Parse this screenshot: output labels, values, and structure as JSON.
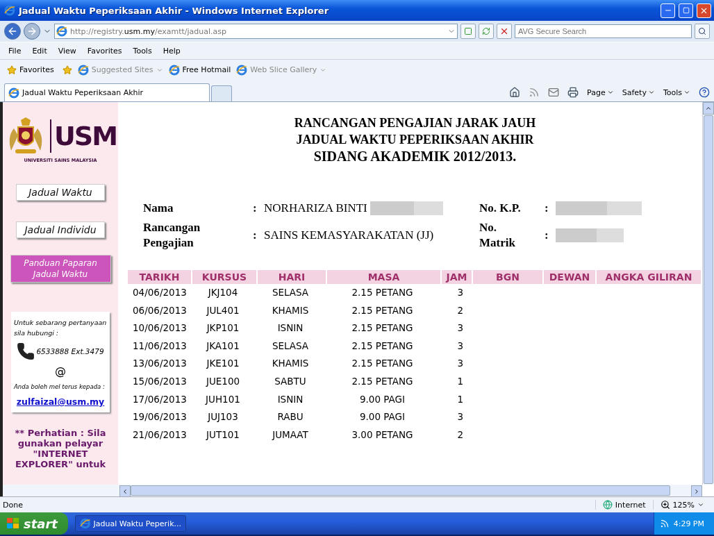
{
  "window": {
    "title": "Jadual Waktu Peperiksaan Akhir - Windows Internet Explorer"
  },
  "address_bar": {
    "url_prefix": "http://registry.",
    "url_host": "usm.my",
    "url_path": "/examtt/jadual.asp",
    "search_placeholder": "AVG Secure Search"
  },
  "menu": [
    "File",
    "Edit",
    "View",
    "Favorites",
    "Tools",
    "Help"
  ],
  "favorites_bar": {
    "favorites": "Favorites",
    "links": [
      {
        "label": "Suggested Sites",
        "dropdown": true,
        "dimmed": true
      },
      {
        "label": "Free Hotmail",
        "dropdown": false,
        "dimmed": false
      },
      {
        "label": "Web Slice Gallery",
        "dropdown": true,
        "dimmed": true
      }
    ]
  },
  "tabs": [
    {
      "label": "Jadual Waktu Peperiksaan Akhir",
      "selected": true
    }
  ],
  "command_bar": [
    "Page",
    "Safety",
    "Tools"
  ],
  "sidebar": {
    "logo_text": "USM",
    "logo_caption": "UNIVERSITI SAINS MALAYSIA",
    "nav": [
      {
        "label": "Jadual Waktu",
        "kind": "plain"
      },
      {
        "label": "Jadual Individu",
        "kind": "plain"
      },
      {
        "label": "Panduan Paparan Jadual Waktu",
        "kind": "highlight"
      }
    ],
    "contact": {
      "intro": "Untuk sebarang pertanyaan sila hubungi :",
      "phone": "6533888 Ext.3479",
      "at": "@",
      "mail_note": "Anda boleh mel terus kepada :",
      "email": "zulfaizal@usm.my"
    },
    "notice": "** Perhatian : Sila gunakan pelayar \"INTERNET EXPLORER\" untuk"
  },
  "heading": [
    "RANCANGAN PENGAJIAN JARAK JAUH",
    "JADUAL WAKTU PEPERIKSAAN AKHIR",
    "SIDANG AKADEMIK 2012/2013."
  ],
  "info": [
    {
      "label": "Nama",
      "separator": ":",
      "value": "NORHARIZA BINTI",
      "redacted": true
    },
    {
      "label": "No. K.P.",
      "separator": ":",
      "redacted": true
    },
    {
      "label": "Rancangan Pengajian",
      "separator": ":",
      "value": "SAINS KEMASYARAKATAN (JJ)",
      "redacted": false
    },
    {
      "label": "No. Matrik",
      "separator": ":",
      "redacted": true
    }
  ],
  "table": {
    "columns": [
      "TARIKH",
      "KURSUS",
      "HARI",
      "MASA",
      "JAM",
      "BGN",
      "DEWAN",
      "ANGKA GILIRAN"
    ],
    "rows": [
      [
        "04/06/2013",
        "JKJ104",
        "SELASA",
        "2.15 PETANG",
        "3"
      ],
      [
        "06/06/2013",
        "JUL401",
        "KHAMIS",
        "2.15 PETANG",
        "2"
      ],
      [
        "10/06/2013",
        "JKP101",
        "ISNIN",
        "2.15 PETANG",
        "3"
      ],
      [
        "11/06/2013",
        "JKA101",
        "SELASA",
        "2.15 PETANG",
        "3"
      ],
      [
        "13/06/2013",
        "JKE101",
        "KHAMIS",
        "2.15 PETANG",
        "3"
      ],
      [
        "15/06/2013",
        "JUE100",
        "SABTU",
        "2.15 PETANG",
        "1"
      ],
      [
        "17/06/2013",
        "JUH101",
        "ISNIN",
        "9.00 PAGI",
        "1"
      ],
      [
        "19/06/2013",
        "JUJ103",
        "RABU",
        "9.00 PAGI",
        "3"
      ],
      [
        "21/06/2013",
        "JUT101",
        "JUMAAT",
        "3.00 PETANG",
        "2"
      ]
    ]
  },
  "status_bar": {
    "status": "Done",
    "zone": "Internet",
    "zoom": "125%"
  },
  "taskbar": {
    "start": "start",
    "tasks": [
      "Jadual Waktu Peperik..."
    ],
    "clock": "4:29 PM"
  }
}
